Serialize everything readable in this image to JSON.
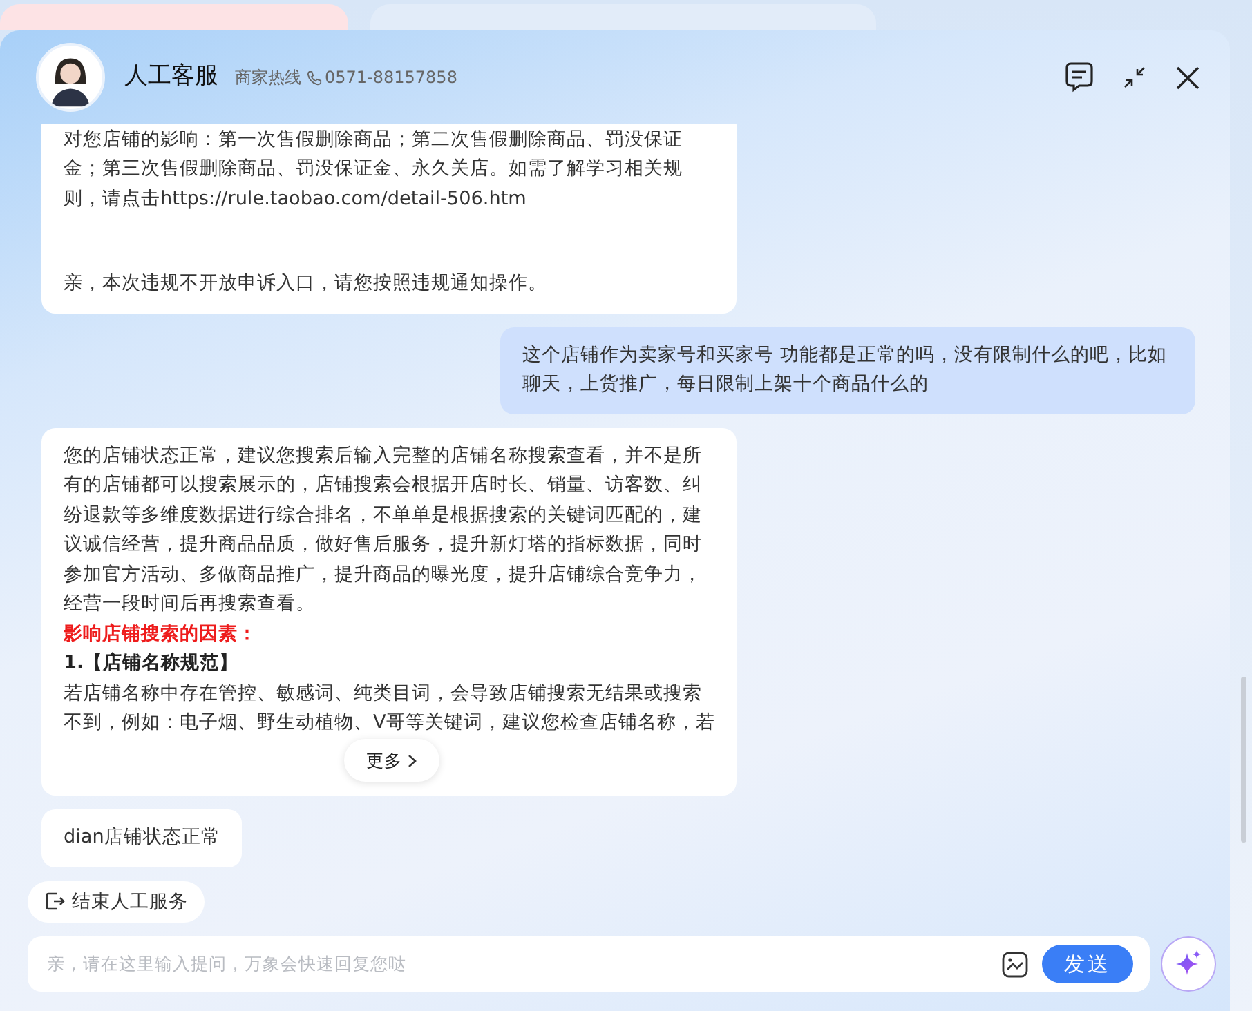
{
  "header": {
    "title": "人工客服",
    "hotline_label": "商家热线",
    "phone": "0571-88157858"
  },
  "messages": [
    {
      "kind": "agent",
      "paragraphs": [
        {
          "kind": "text",
          "text": "对您店铺的影响：第一次售假删除商品；第二次售假删除商品、罚没保证金；第三次售假删除商品、罚没保证金、永久关店。如需了解学习相关规则，请点击https://rule.taobao.com/detail-506.htm"
        },
        {
          "kind": "spacer"
        },
        {
          "kind": "text",
          "text": "亲，本次违规不开放申诉入口，请您按照违规通知操作。"
        }
      ]
    },
    {
      "kind": "user",
      "paragraphs": [
        {
          "kind": "text",
          "text": "这个店铺作为卖家号和买家号 功能都是正常的吗，没有限制什么的吧，比如聊天，上货推广，每日限制上架十个商品什么的"
        }
      ]
    },
    {
      "kind": "agent",
      "collapsed": true,
      "more": "更多",
      "paragraphs": [
        {
          "kind": "text",
          "text": "您的店铺状态正常，建议您搜索后输入完整的店铺名称搜索查看，并不是所有的店铺都可以搜索展示的，店铺搜索会根据开店时长、销量、访客数、纠纷退款等多维度数据进行综合排名，不单单是根据搜索的关键词匹配的，建议诚信经营，提升商品品质，做好售后服务，提升新灯塔的指标数据，同时参加官方活动、多做商品推广，提升商品的曝光度，提升店铺综合竞争力，经营一段时间后再搜索查看。"
        },
        {
          "kind": "heading",
          "text": "影响店铺搜索的因素："
        },
        {
          "kind": "subheading",
          "text": "1.【店铺名称规范】"
        },
        {
          "kind": "text",
          "text": "若店铺名称中存在管控、敏感词、纯类目词，会导致店铺搜索无结果或搜索不到，例如：电子烟、野生动植物、V哥等关键词，建议您检查店铺名称，若"
        }
      ]
    },
    {
      "kind": "agent",
      "paragraphs": [
        {
          "kind": "text",
          "text": "dian店铺状态正常"
        }
      ]
    }
  ],
  "end_service": "结束人工服务",
  "input": {
    "placeholder": "亲，请在这里输入提问，万象会快速回复您哒"
  },
  "send": "发送"
}
